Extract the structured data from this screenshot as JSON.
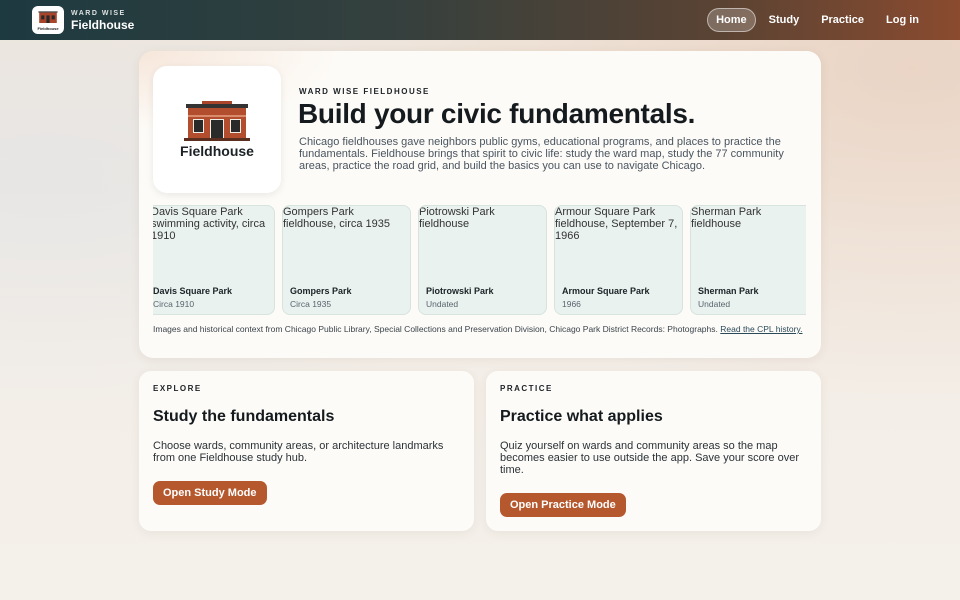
{
  "brand": {
    "small": "WARD WISE",
    "name": "Fieldhouse",
    "logo_label": "Fieldhouse"
  },
  "nav": {
    "home": "Home",
    "study": "Study",
    "practice": "Practice",
    "login": "Log in"
  },
  "hero": {
    "eyebrow": "WARD WISE FIELDHOUSE",
    "title": "Build your civic fundamentals.",
    "description": "Chicago fieldhouses gave neighbors public gyms, educational programs, and places to practice the fundamentals. Fieldhouse brings that spirit to civic life: study the ward map, study the 77 community areas, practice the road grid, and build the basics you can use to navigate Chicago.",
    "logo_label": "Fieldhouse"
  },
  "parks": [
    {
      "alt": "Davis Square Park swimming activity, circa 1910",
      "name": "Davis Square Park",
      "date": "Circa 1910"
    },
    {
      "alt": "Gompers Park fieldhouse, circa 1935",
      "name": "Gompers Park",
      "date": "Circa 1935"
    },
    {
      "alt": "Piotrowski Park fieldhouse",
      "name": "Piotrowski Park",
      "date": "Undated"
    },
    {
      "alt": "Armour Square Park fieldhouse, September 7, 1966",
      "name": "Armour Square Park",
      "date": "1966"
    },
    {
      "alt": "Sherman Park fieldhouse",
      "name": "Sherman Park",
      "date": "Undated"
    }
  ],
  "credit": {
    "text": "Images and historical context from Chicago Public Library, Special Collections and Preservation Division, Chicago Park District Records: Photographs.",
    "link": "Read the CPL history."
  },
  "explore": {
    "eyebrow": "EXPLORE",
    "title": "Study the fundamentals",
    "description": "Choose wards, community areas, or architecture landmarks from one Fieldhouse study hub.",
    "button": "Open Study Mode"
  },
  "practice": {
    "eyebrow": "PRACTICE",
    "title": "Practice what applies",
    "description": "Quiz yourself on wards and community areas so the map becomes easier to use outside the app. Save your score over time.",
    "button": "Open Practice Mode"
  },
  "colors": {
    "accent": "#b5582e",
    "brick": "#a8452a",
    "card_bg": "#e9f2ef"
  }
}
